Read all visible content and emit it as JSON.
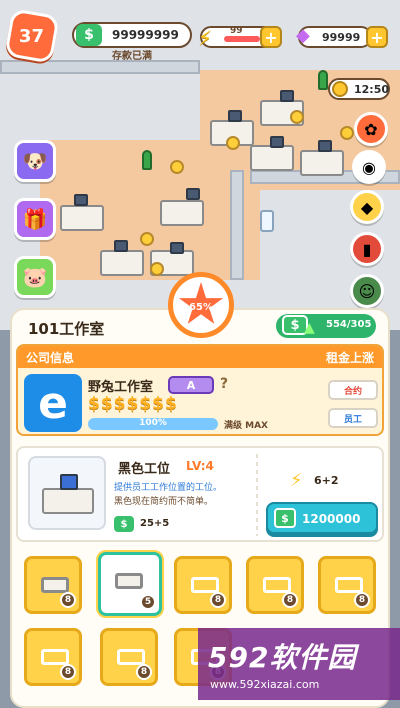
{
  "hud": {
    "level": "37",
    "money": "99999999",
    "money_note": "存款已满",
    "energy": "99",
    "energy_fill": 0.85,
    "gems": "99999",
    "clock": "12:50"
  },
  "panel": {
    "progress": "65%",
    "office_name": "101工作室",
    "capacity": "554/305",
    "company_header_left": "公司信息",
    "company_header_right": "租金上涨",
    "company_name": "野兔工作室",
    "company_grade": "A",
    "company_help": "?",
    "company_logo": "e",
    "rating_icons": "$$$$$$$",
    "rating_percent": "100%",
    "rating_fill": 1.0,
    "rating_max": "满级 MAX",
    "btn_contract": "合约",
    "btn_staff": "员工"
  },
  "upgrade": {
    "title": "黑色工位",
    "level": "LV:4",
    "desc": "提供员工工作位置的工位。",
    "desc2": "黑色现在简约而不简单。",
    "income": "25+5",
    "energy": "6+2",
    "cost": "1200000"
  },
  "slots": [
    {
      "count": "8",
      "filled": true
    },
    {
      "count": "5",
      "filled": true,
      "selected": true
    },
    {
      "count": "8"
    },
    {
      "count": "8"
    },
    {
      "count": "8"
    },
    {
      "count": "8"
    },
    {
      "count": "8"
    },
    {
      "count": "8"
    }
  ],
  "watermark": {
    "title": "592软件园",
    "url": "www.592xiazai.com"
  },
  "colors": {
    "accent": "#ff9a2a",
    "money_green": "#39c06c",
    "buy_blue": "#2ec2d8"
  }
}
